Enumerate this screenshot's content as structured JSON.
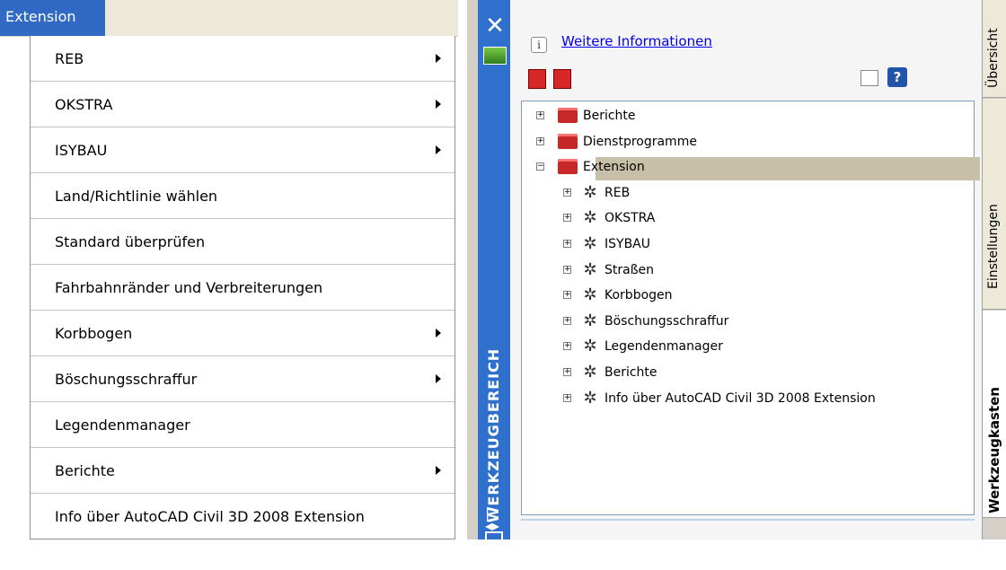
{
  "menubar": {
    "active_item": "Extension"
  },
  "menu": {
    "items": [
      {
        "label": "REB",
        "submenu": true
      },
      {
        "label": "OKSTRA",
        "submenu": true
      },
      {
        "label": "ISYBAU",
        "submenu": true
      },
      {
        "label": "Land/Richtlinie wählen",
        "submenu": false
      },
      {
        "label": "Standard überprüfen",
        "submenu": false
      },
      {
        "label": "Fahrbahnränder und Verbreiterungen",
        "submenu": false
      },
      {
        "label": "Korbbogen",
        "submenu": true
      },
      {
        "label": "Böschungsschraffur",
        "submenu": true
      },
      {
        "label": "Legendenmanager",
        "submenu": false
      },
      {
        "label": "Berichte",
        "submenu": true
      },
      {
        "label": "Info über AutoCAD Civil 3D 2008 Extension",
        "submenu": false
      }
    ]
  },
  "palette": {
    "title": "WERKZEUGBEREICH",
    "info_link": "Weitere Informationen",
    "info_icon": "i",
    "help_icon": "?",
    "tree": {
      "roots": [
        {
          "label": "Berichte",
          "expanded": false
        },
        {
          "label": "Dienstprogramme",
          "expanded": false
        },
        {
          "label": "Extension",
          "expanded": true,
          "selected": true
        }
      ],
      "children": [
        {
          "label": "REB"
        },
        {
          "label": "OKSTRA"
        },
        {
          "label": "ISYBAU"
        },
        {
          "label": "Straßen"
        },
        {
          "label": "Korbbogen"
        },
        {
          "label": "Böschungsschraffur"
        },
        {
          "label": "Legendenmanager"
        },
        {
          "label": "Berichte"
        },
        {
          "label": "Info über AutoCAD Civil 3D 2008 Extension"
        }
      ]
    },
    "tabs": [
      {
        "label": "Übersicht"
      },
      {
        "label": "Einstellungen"
      },
      {
        "label": "Werkzeugkasten",
        "active": true
      }
    ]
  },
  "colors": {
    "menu_highlight": "#316ac5",
    "palette_titlebar": "#2e70cc",
    "tree_selection": "#c8bfa8",
    "folder_icon": "#c62828"
  }
}
